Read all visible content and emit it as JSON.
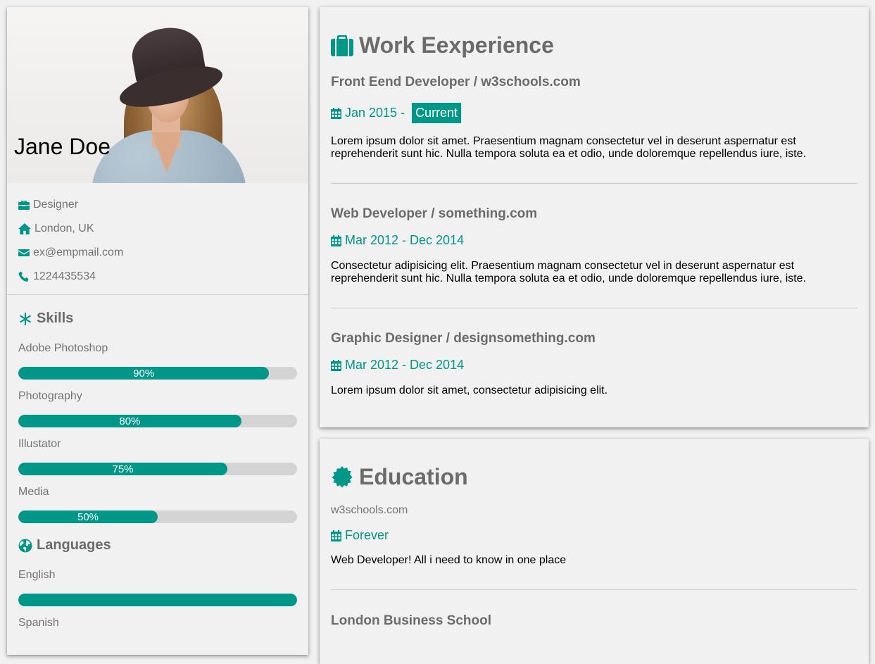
{
  "profile": {
    "name": "Jane Doe",
    "info": [
      {
        "icon": "briefcase-icon",
        "text": "Designer"
      },
      {
        "icon": "home-icon",
        "text": "London, UK"
      },
      {
        "icon": "envelope-icon",
        "text": "ex@empmail.com"
      },
      {
        "icon": "phone-icon",
        "text": "1224435534"
      }
    ]
  },
  "skills": {
    "title": "Skills",
    "items": [
      {
        "label": "Adobe Photoshop",
        "percent": 90,
        "text": "90%"
      },
      {
        "label": "Photography",
        "percent": 80,
        "text": "80%"
      },
      {
        "label": "Illustator",
        "percent": 75,
        "text": "75%"
      },
      {
        "label": "Media",
        "percent": 50,
        "text": "50%"
      }
    ]
  },
  "languages": {
    "title": "Languages",
    "items": [
      {
        "label": "English",
        "percent": 100
      },
      {
        "label": "Spanish"
      }
    ]
  },
  "work": {
    "title": "Work Eexperience",
    "jobs": [
      {
        "title": "Front Eend Developer / w3schools.com",
        "date": "Jan 2015 - ",
        "tag": "Current",
        "desc": "Lorem ipsum dolor sit amet. Praesentium magnam consectetur vel in deserunt aspernatur est reprehenderit sunt hic. Nulla tempora soluta ea et odio, unde doloremque repellendus iure, iste."
      },
      {
        "title": "Web Developer / something.com",
        "date": "Mar 2012 - Dec 2014",
        "desc": "Consectetur adipisicing elit. Praesentium magnam consectetur vel in deserunt aspernatur est reprehenderit sunt hic. Nulla tempora soluta ea et odio, unde doloremque repellendus iure, iste."
      },
      {
        "title": "Graphic Designer / designsomething.com",
        "date": "Mar 2012 - Dec 2014",
        "desc": "Lorem ipsum dolor sit amet, consectetur adipisicing elit."
      }
    ]
  },
  "education": {
    "title": "Education",
    "entries": [
      {
        "school": "w3schools.com",
        "date": "Forever",
        "desc": "Web Developer! All i need to know in one place"
      },
      {
        "school": "London Business School"
      }
    ]
  },
  "colors": {
    "accent": "#009688",
    "background": "#f1f1f1",
    "bar_bg": "#d4d4d4",
    "heading": "#6b6b6b"
  }
}
